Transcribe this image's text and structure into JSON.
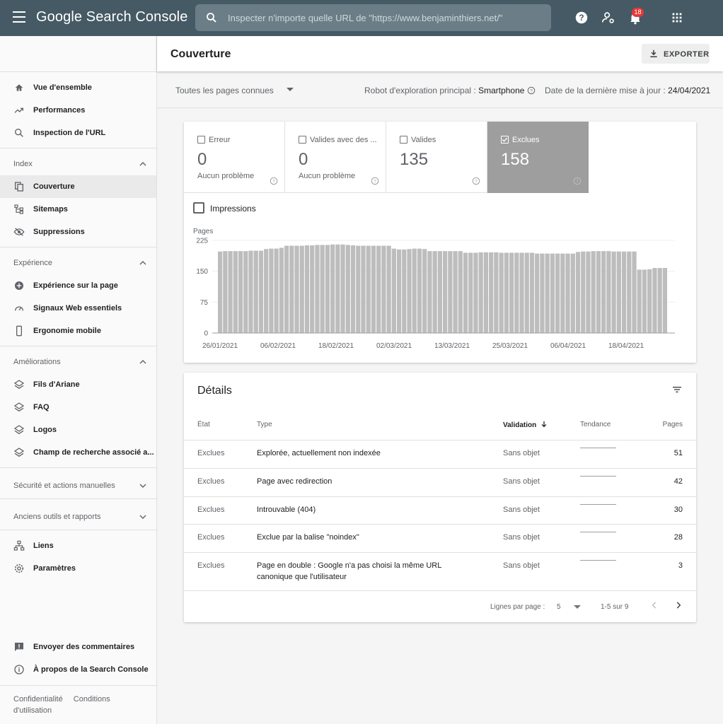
{
  "app": {
    "brand": "Google Search Console",
    "search_placeholder": "Inspecter n'importe quelle URL de \"https://www.benjaminthiers.net/\"",
    "notifications_count": "18"
  },
  "sidebar": {
    "top_items": [
      {
        "label": "Vue d'ensemble",
        "icon": "home-icon"
      },
      {
        "label": "Performances",
        "icon": "trending-up-icon"
      },
      {
        "label": "Inspection de l'URL",
        "icon": "search-icon"
      }
    ],
    "sections": [
      {
        "title": "Index",
        "items": [
          {
            "label": "Couverture",
            "icon": "file-copy-icon",
            "active": true
          },
          {
            "label": "Sitemaps",
            "icon": "sitemap-icon"
          },
          {
            "label": "Suppressions",
            "icon": "eye-off-icon"
          }
        ]
      },
      {
        "title": "Expérience",
        "items": [
          {
            "label": "Expérience sur la page",
            "icon": "plus-circle-icon"
          },
          {
            "label": "Signaux Web essentiels",
            "icon": "speedometer-icon"
          },
          {
            "label": "Ergonomie mobile",
            "icon": "smartphone-icon"
          }
        ]
      },
      {
        "title": "Améliorations",
        "items": [
          {
            "label": "Fils d'Ariane",
            "icon": "layers-icon"
          },
          {
            "label": "FAQ",
            "icon": "layers-icon"
          },
          {
            "label": "Logos",
            "icon": "layers-icon"
          },
          {
            "label": "Champ de recherche associé a...",
            "icon": "layers-icon"
          }
        ]
      }
    ],
    "collapsed_sections": [
      "Sécurité et actions manuelles",
      "Anciens outils et rapports"
    ],
    "bottom_items": [
      {
        "label": "Liens",
        "icon": "network-icon"
      },
      {
        "label": "Paramètres",
        "icon": "gear-icon"
      }
    ],
    "footer_items": [
      {
        "label": "Envoyer des commentaires",
        "icon": "feedback-icon"
      },
      {
        "label": "À propos de la Search Console",
        "icon": "info-icon"
      }
    ],
    "footer_links": [
      "Confidentialité",
      "Conditions d'utilisation"
    ]
  },
  "page": {
    "title": "Couverture",
    "export_label": "EXPORTER",
    "filter_select": "Toutes les pages connues",
    "robot_label": "Robot d'exploration principal :",
    "robot_value": "Smartphone",
    "date_label": "Date de la dernière mise à jour :",
    "date_value": "24/04/2021"
  },
  "stats": [
    {
      "label": "Erreur",
      "value": "0",
      "sub": "Aucun problème",
      "selected": false
    },
    {
      "label": "Valides avec des ...",
      "value": "0",
      "sub": "Aucun problème",
      "selected": false
    },
    {
      "label": "Valides",
      "value": "135",
      "sub": "",
      "selected": false
    },
    {
      "label": "Exclues",
      "value": "158",
      "sub": "",
      "selected": true
    }
  ],
  "impressions_label": "Impressions",
  "chart_data": {
    "type": "bar",
    "ylabel": "Pages",
    "yticks": [
      0,
      75,
      150,
      225
    ],
    "ylim": [
      0,
      225
    ],
    "xtick_labels": [
      "26/01/2021",
      "06/02/2021",
      "18/02/2021",
      "02/03/2021",
      "13/03/2021",
      "25/03/2021",
      "06/04/2021",
      "18/04/2021"
    ],
    "grid": true,
    "bar_color": "#bdbdbd",
    "values": [
      198,
      199,
      199,
      199,
      199,
      199,
      200,
      200,
      200,
      204,
      205,
      205,
      207,
      212,
      212,
      212,
      212,
      213,
      213,
      214,
      214,
      214,
      215,
      215,
      215,
      214,
      213,
      212,
      212,
      212,
      212,
      212,
      212,
      212,
      205,
      203,
      203,
      204,
      205,
      205,
      204,
      199,
      199,
      199,
      199,
      199,
      199,
      199,
      195,
      195,
      195,
      196,
      196,
      196,
      196,
      195,
      195,
      195,
      195,
      195,
      195,
      195,
      193,
      193,
      193,
      193,
      193,
      193,
      193,
      193,
      197,
      198,
      198,
      199,
      199,
      199,
      199,
      198,
      198,
      198,
      198,
      198,
      154,
      154,
      155,
      158,
      158,
      158
    ]
  },
  "details": {
    "title": "Détails",
    "headers": {
      "state": "État",
      "type": "Type",
      "validation": "Validation",
      "trend": "Tendance",
      "pages": "Pages"
    },
    "rows": [
      {
        "state": "Exclues",
        "type": "Explorée, actuellement non indexée",
        "validation": "Sans objet",
        "pages": "51"
      },
      {
        "state": "Exclues",
        "type": "Page avec redirection",
        "validation": "Sans objet",
        "pages": "42"
      },
      {
        "state": "Exclues",
        "type": "Introuvable (404)",
        "validation": "Sans objet",
        "pages": "30"
      },
      {
        "state": "Exclues",
        "type": "Exclue par la balise \"noindex\"",
        "validation": "Sans objet",
        "pages": "28"
      },
      {
        "state": "Exclues",
        "type": "Page en double : Google n'a pas choisi la même URL canonique que l'utilisateur",
        "validation": "Sans objet",
        "pages": "3"
      }
    ],
    "pager": {
      "rows_label": "Lignes par page :",
      "rows_value": "5",
      "range": "1-5 sur 9"
    }
  }
}
